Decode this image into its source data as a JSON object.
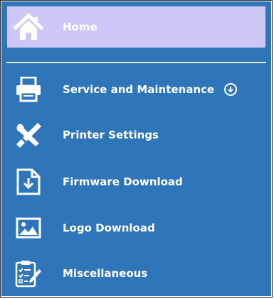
{
  "menu": {
    "items": [
      {
        "label": "Home",
        "icon": "home-icon",
        "selected": true
      },
      {
        "label": "Service and Maintenance",
        "icon": "printer-icon",
        "expandable": true,
        "expand_icon": "circle-arrow-down-icon"
      },
      {
        "label": "Printer Settings",
        "icon": "tools-icon"
      },
      {
        "label": "Firmware Download",
        "icon": "file-download-icon"
      },
      {
        "label": "Logo Download",
        "icon": "image-icon"
      },
      {
        "label": "Miscellaneous",
        "icon": "checklist-icon"
      }
    ]
  },
  "colors": {
    "panel_bg": "#2f75b9",
    "selected_bg": "#ccc7f6",
    "text": "#ffffff"
  }
}
